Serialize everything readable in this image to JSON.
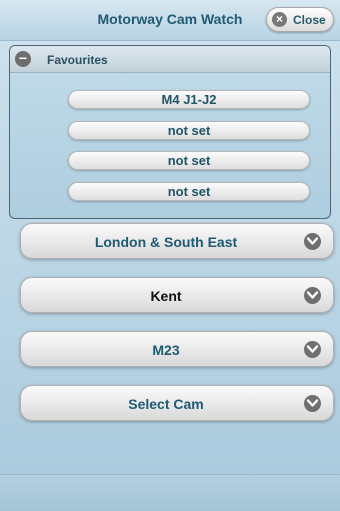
{
  "header": {
    "title": "Motorway Cam Watch",
    "close_label": "Close"
  },
  "favourites": {
    "title": "Favourites",
    "items": [
      {
        "label": "M4 J1-J2"
      },
      {
        "label": "not set"
      },
      {
        "label": "not set"
      },
      {
        "label": "not set"
      }
    ]
  },
  "selects": [
    {
      "label": "London & South East",
      "color": "#1f5a73"
    },
    {
      "label": "Kent",
      "color": "#111111"
    },
    {
      "label": "M23",
      "color": "#1f5a73"
    },
    {
      "label": "Select Cam",
      "color": "#1f5a73"
    }
  ],
  "icons": {
    "close": "close-icon",
    "collapse": "minus-icon",
    "dropdown": "chevron-down-icon"
  }
}
